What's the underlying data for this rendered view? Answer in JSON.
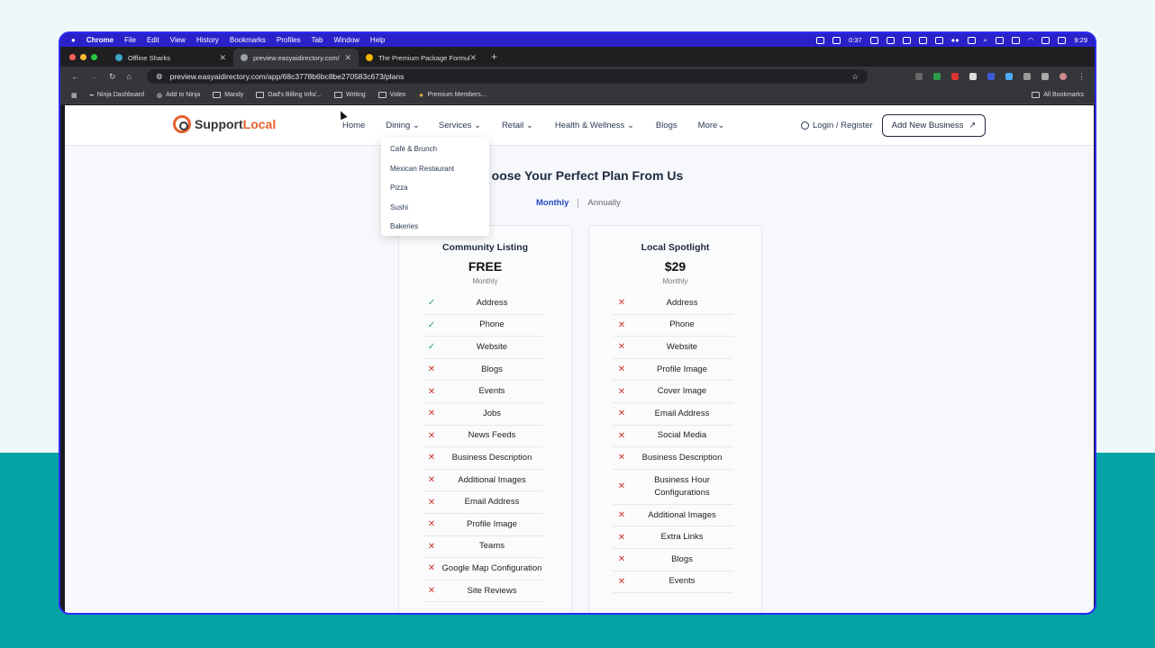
{
  "macos_menubar": {
    "items": [
      "Chrome",
      "File",
      "Edit",
      "View",
      "History",
      "Bookmarks",
      "Profiles",
      "Tab",
      "Window",
      "Help"
    ],
    "timer": "0:37",
    "clock": "9:29"
  },
  "browser": {
    "tabs": [
      {
        "label": "Offline Sharks",
        "close": "✕"
      },
      {
        "label": "preview.easyaidirectory.com/",
        "close": "✕"
      },
      {
        "label": "The Premium Package Formul",
        "close": "✕"
      }
    ],
    "new_tab": "+",
    "url": "preview.easyaidirectory.com/app/68c3778b6bc8be270583c673/plans",
    "bookmarks": [
      "Ninja Dashboard",
      "Add to Ninja",
      "Mandy",
      "Dad's Billing Info/...",
      "Writing",
      "Video",
      "Premium Members..."
    ],
    "all_bookmarks": "All Bookmarks"
  },
  "site": {
    "logo_a": "Support",
    "logo_b": "Local",
    "nav": [
      "Home",
      "Dining",
      "Services",
      "Retail",
      "Health & Wellness",
      "Blogs",
      "More"
    ],
    "login": "Login / Register",
    "add_business": "Add New Business",
    "dining_dropdown": [
      "Café & Brunch",
      "Mexican Restaurant",
      "Pizza",
      "Sushi",
      "Bakeries"
    ],
    "heading": "oose Your Perfect Plan From Us",
    "toggle_monthly": "Monthly",
    "toggle_annually": "Annually",
    "plans": [
      {
        "title": "Community Listing",
        "price": "FREE",
        "period": "Monthly",
        "features": [
          {
            "label": "Address",
            "included": true
          },
          {
            "label": "Phone",
            "included": true
          },
          {
            "label": "Website",
            "included": true
          },
          {
            "label": "Blogs",
            "included": false
          },
          {
            "label": "Events",
            "included": false
          },
          {
            "label": "Jobs",
            "included": false
          },
          {
            "label": "News Feeds",
            "included": false
          },
          {
            "label": "Business Description",
            "included": false
          },
          {
            "label": "Additional Images",
            "included": false
          },
          {
            "label": "Email Address",
            "included": false
          },
          {
            "label": "Profile Image",
            "included": false
          },
          {
            "label": "Teams",
            "included": false
          },
          {
            "label": "Google Map Configuration",
            "included": false
          },
          {
            "label": "Site Reviews",
            "included": false
          }
        ]
      },
      {
        "title": "Local Spotlight",
        "price": "$29",
        "period": "Monthly",
        "features": [
          {
            "label": "Address",
            "included": false
          },
          {
            "label": "Phone",
            "included": false
          },
          {
            "label": "Website",
            "included": false
          },
          {
            "label": "Profile Image",
            "included": false
          },
          {
            "label": "Cover Image",
            "included": false
          },
          {
            "label": "Email Address",
            "included": false
          },
          {
            "label": "Social Media",
            "included": false
          },
          {
            "label": "Business Description",
            "included": false
          },
          {
            "label": "Business Hour Configurations",
            "included": false
          },
          {
            "label": "Additional Images",
            "included": false
          },
          {
            "label": "Extra Links",
            "included": false
          },
          {
            "label": "Blogs",
            "included": false
          },
          {
            "label": "Events",
            "included": false
          }
        ]
      }
    ]
  },
  "colors": {
    "accent": "#2649c9",
    "brand": "#e4602e",
    "check": "#38a36a",
    "cross": "#d0352f",
    "teal": "#05a3a5"
  }
}
